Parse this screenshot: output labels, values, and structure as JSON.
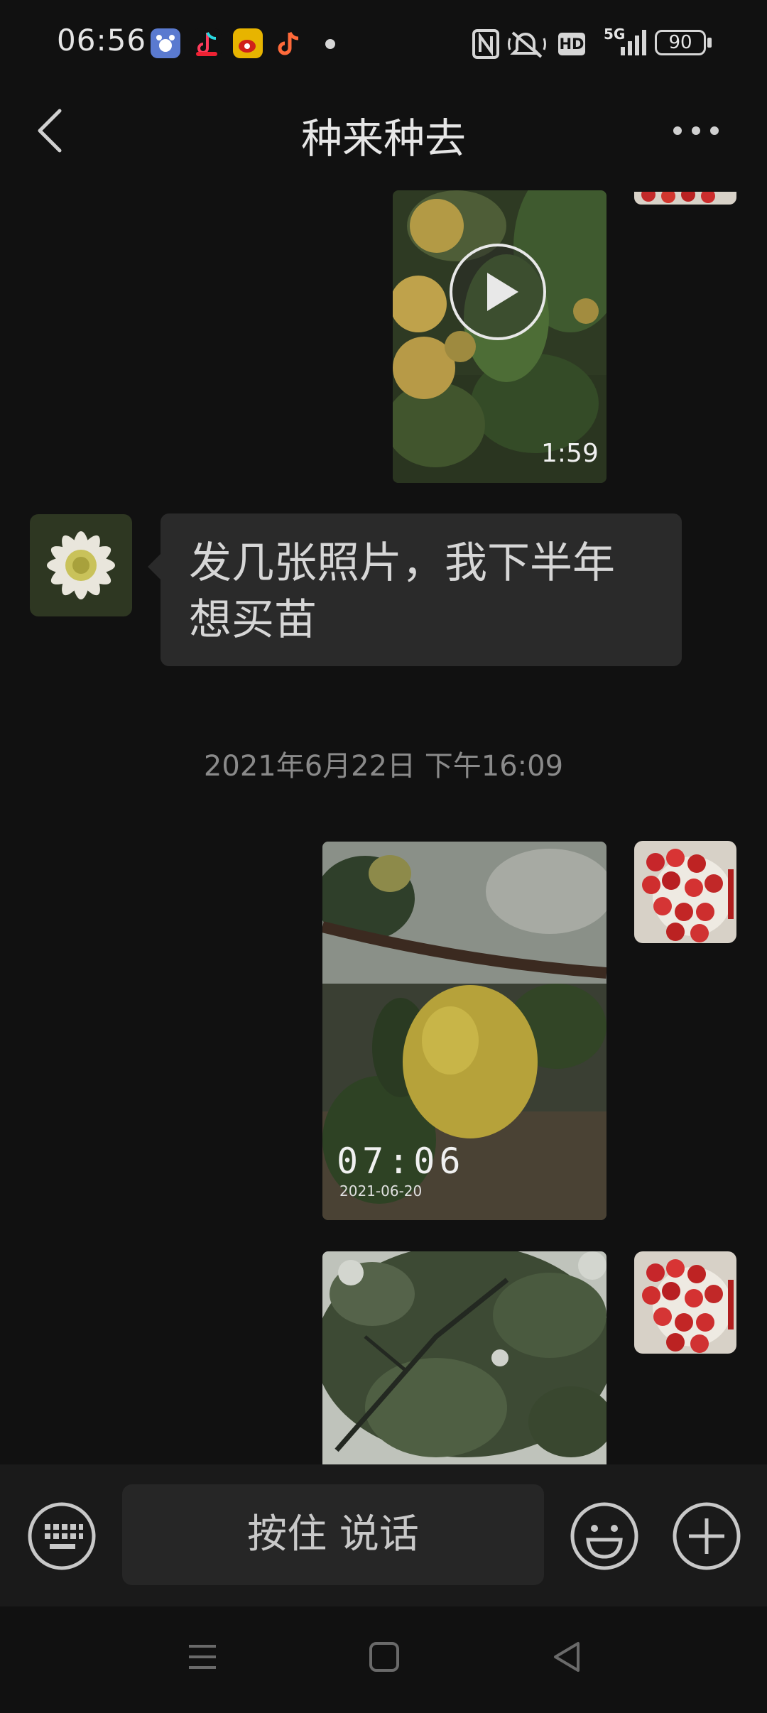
{
  "status_bar": {
    "time": "06:56",
    "battery": "90",
    "network": "5G",
    "hd": "HD",
    "icons": [
      "baidu-app-icon",
      "douyin-speed-icon",
      "weibo-icon",
      "douyin-icon",
      "nfc-icon",
      "mute-icon",
      "hd-icon",
      "signal-icon",
      "battery-icon"
    ]
  },
  "header": {
    "title": "种来种去",
    "back_icon": "back-arrow-icon",
    "more_icon": "more-dots-icon"
  },
  "messages": {
    "video_duration": "1:59",
    "text_message": "发几张照片，我下半年想买苗",
    "timestamp": "2021年6月22日 下午16:09",
    "photo_clock": "07:06",
    "photo_date": "2021-06-20"
  },
  "input_bar": {
    "hold_to_talk": "按住 说话",
    "icons": [
      "keyboard-icon",
      "emoji-icon",
      "add-icon"
    ]
  },
  "nav_bar": {
    "icons": [
      "menu-icon",
      "home-icon",
      "back-icon"
    ]
  },
  "colors": {
    "background": "#111111",
    "bubble": "#2a2a2a",
    "input_bar": "#1a1a1a"
  }
}
